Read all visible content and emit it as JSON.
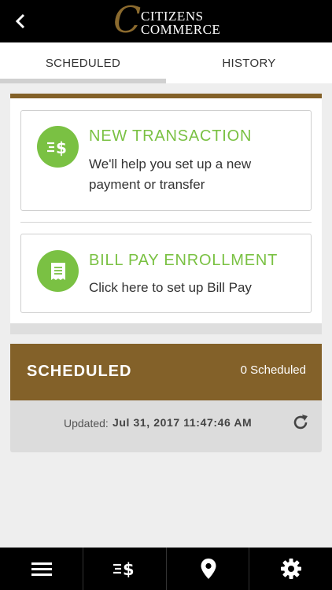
{
  "header": {
    "logo_initial": "C",
    "logo_line1": "CITIZENS",
    "logo_line2": "COMMERCE",
    "back_icon": "chevron-left-icon"
  },
  "tabs": [
    {
      "label": "SCHEDULED",
      "active": true
    },
    {
      "label": "HISTORY",
      "active": false
    }
  ],
  "cards": {
    "new_transaction": {
      "title": "NEW TRANSACTION",
      "description": "We'll help you set up a new payment or transfer",
      "icon": "transfer-dollar-icon"
    },
    "bill_pay": {
      "title": "BILL PAY ENROLLMENT",
      "description": "Click here to set up Bill Pay",
      "icon": "bill-receipt-icon"
    }
  },
  "scheduled": {
    "title": "SCHEDULED",
    "count_text": "0 Scheduled",
    "updated_label": "Updated:",
    "updated_value": "Jul 31, 2017 11:47:46 AM",
    "refresh_icon": "refresh-icon"
  },
  "bottom_nav": [
    {
      "icon": "menu-icon"
    },
    {
      "icon": "transfer-dollar-icon"
    },
    {
      "icon": "location-pin-icon"
    },
    {
      "icon": "gear-icon"
    }
  ],
  "colors": {
    "brand_brown": "#836129",
    "accent_green": "#7ac143",
    "header_black": "#000000"
  }
}
